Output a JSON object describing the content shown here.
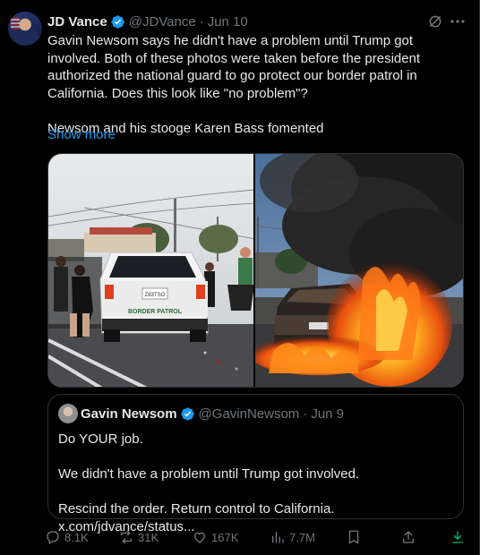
{
  "author": {
    "name": "JD Vance",
    "handle": "@JDVance",
    "separator": "·",
    "date": "Jun 10"
  },
  "tweet": {
    "paragraphs": [
      "Gavin Newsom says he didn't have a problem until Trump got involved. Both of these photos were taken before the president authorized the national guard to go protect our border patrol in California. Does this look like \"no problem\"?",
      "Newsom and his stooge Karen Bass fomented"
    ],
    "show_more": "Show more"
  },
  "media": {
    "left_photo": {
      "vehicle_text": "BORDER PATROL",
      "plate": "Z83TSO"
    },
    "right_photo": {}
  },
  "quoted_tweet": {
    "name": "Gavin Newsom",
    "handle": "@GavinNewsom",
    "separator": "·",
    "date": "Jun 9",
    "paragraphs": [
      "Do YOUR job.",
      "We didn't have a problem until Trump got involved.",
      "Rescind the order. Return control to California. x.com/jdvance/status..."
    ]
  },
  "actions": {
    "replies": "8.1K",
    "reposts": "31K",
    "likes": "167K",
    "views": "7.7M"
  },
  "colors": {
    "background": "#000000",
    "text": "#e7e9ea",
    "muted": "#71767b",
    "link": "#1d9bf0",
    "border": "#2f3336",
    "verified": "#1d9bf0"
  }
}
